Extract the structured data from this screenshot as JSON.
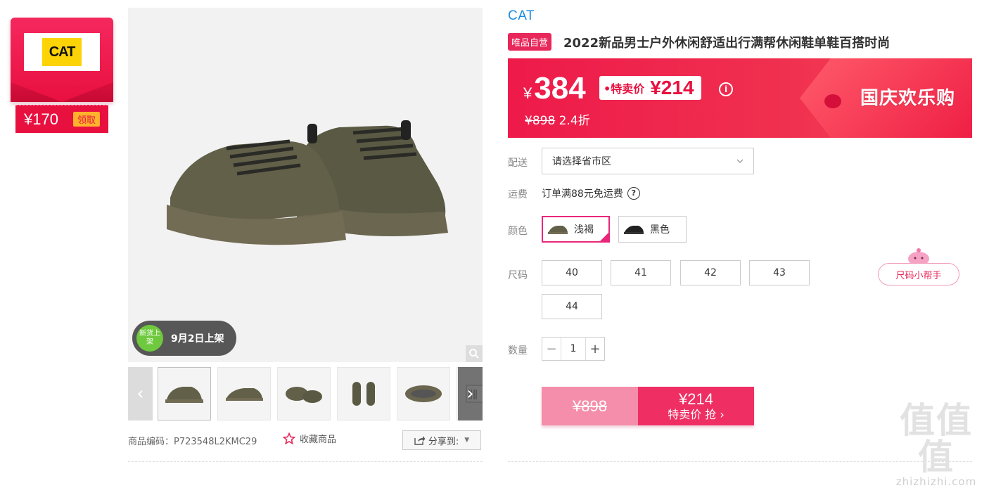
{
  "coupon": {
    "brand_logo_text": "CAT",
    "price": "¥170",
    "take_label": "领取"
  },
  "gallery": {
    "new_badge_circle": "新货上架",
    "new_badge_text": "9月2日上架",
    "thumbnails": [
      "thumb-1",
      "thumb-2",
      "thumb-3",
      "thumb-4",
      "thumb-5",
      "thumb-6"
    ]
  },
  "meta": {
    "sku": "商品编码：P723548L2KMC29",
    "favorite_label": "收藏商品",
    "share_label": "分享到:"
  },
  "product": {
    "brand": "CAT",
    "self_tag": "唯品自营",
    "title": "2022新品男士户外休闲舒适出行满帮休闲鞋单鞋百搭时尚"
  },
  "price": {
    "current_yen": "¥",
    "current": "384",
    "special_label": "•特卖价",
    "special_price": "¥214",
    "original": "¥898",
    "discount": "2.4折",
    "promo": "国庆欢乐购"
  },
  "delivery": {
    "label": "配送",
    "select_text": "请选择省市区"
  },
  "freight": {
    "label": "运费",
    "text": "订单满88元免运费"
  },
  "color": {
    "label": "颜色",
    "options": [
      {
        "name": "浅褐",
        "selected": true
      },
      {
        "name": "黑色",
        "selected": false
      }
    ]
  },
  "size": {
    "label": "尺码",
    "options": [
      "40",
      "41",
      "42",
      "43",
      "44"
    ],
    "helper": "尺码小帮手"
  },
  "quantity": {
    "label": "数量",
    "value": "1"
  },
  "buy": {
    "orig_price": "¥898",
    "price": "¥214",
    "label": "特卖价 抢 ›"
  },
  "watermark": {
    "big": "值值值",
    "small": "zhizhizhi.com"
  }
}
